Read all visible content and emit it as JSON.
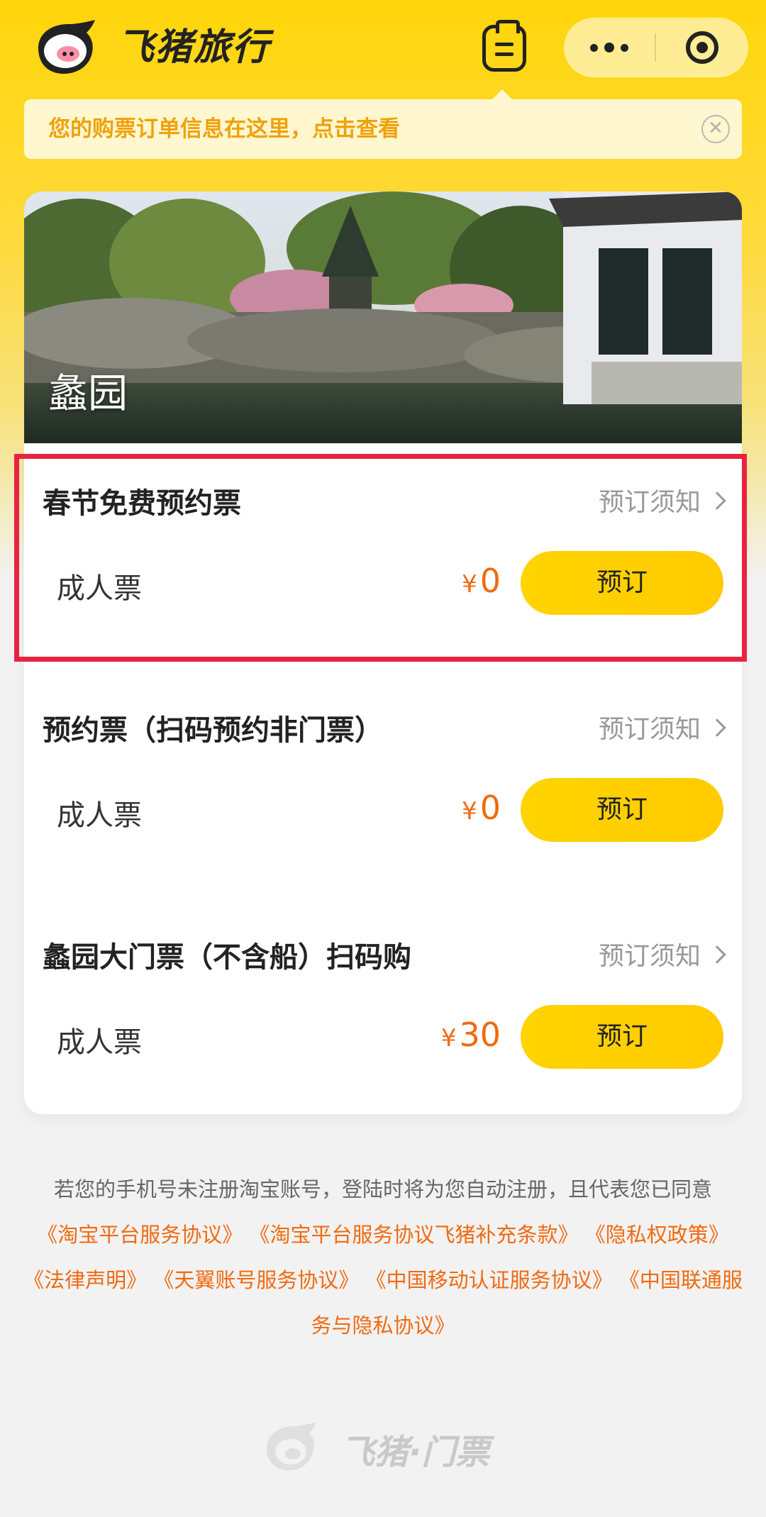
{
  "header": {
    "brand": "飞猪旅行",
    "icons": {
      "logo": "fliggy-pig-logo",
      "orders": "order-list-icon",
      "more": "more-dots-icon",
      "close": "target-close-icon"
    }
  },
  "tip": {
    "text": "您的购票订单信息在这里，点击查看",
    "close_symbol": "✕"
  },
  "attraction": {
    "name": "蠡园"
  },
  "tickets": [
    {
      "title": "春节免费预约票",
      "notice": "预订须知",
      "type": "成人票",
      "currency": "¥",
      "price": "0",
      "book": "预订"
    },
    {
      "title": "预约票（扫码预约非门票）",
      "notice": "预订须知",
      "type": "成人票",
      "currency": "¥",
      "price": "0",
      "book": "预订"
    },
    {
      "title": "蠡园大门票（不含船）扫码购",
      "notice": "预订须知",
      "type": "成人票",
      "currency": "¥",
      "price": "30",
      "book": "预订"
    }
  ],
  "legal": {
    "intro": "若您的手机号未注册淘宝账号，登陆时将为您自动注册，且代表您已同意",
    "links": [
      "《淘宝平台服务协议》",
      "《淘宝平台服务协议飞猪补充条款》",
      "《隐私权政策》",
      "《法律声明》",
      "《天翼账号服务协议》",
      "《中国移动认证服务协议》",
      "《中国联通服务与隐私协议》"
    ]
  },
  "footer": {
    "brand": "飞猪·门票"
  },
  "colors": {
    "brand_yellow": "#ffd60a",
    "price_orange": "#f06a10",
    "highlight_red": "#e8233f",
    "link_orange": "#f06a10"
  }
}
